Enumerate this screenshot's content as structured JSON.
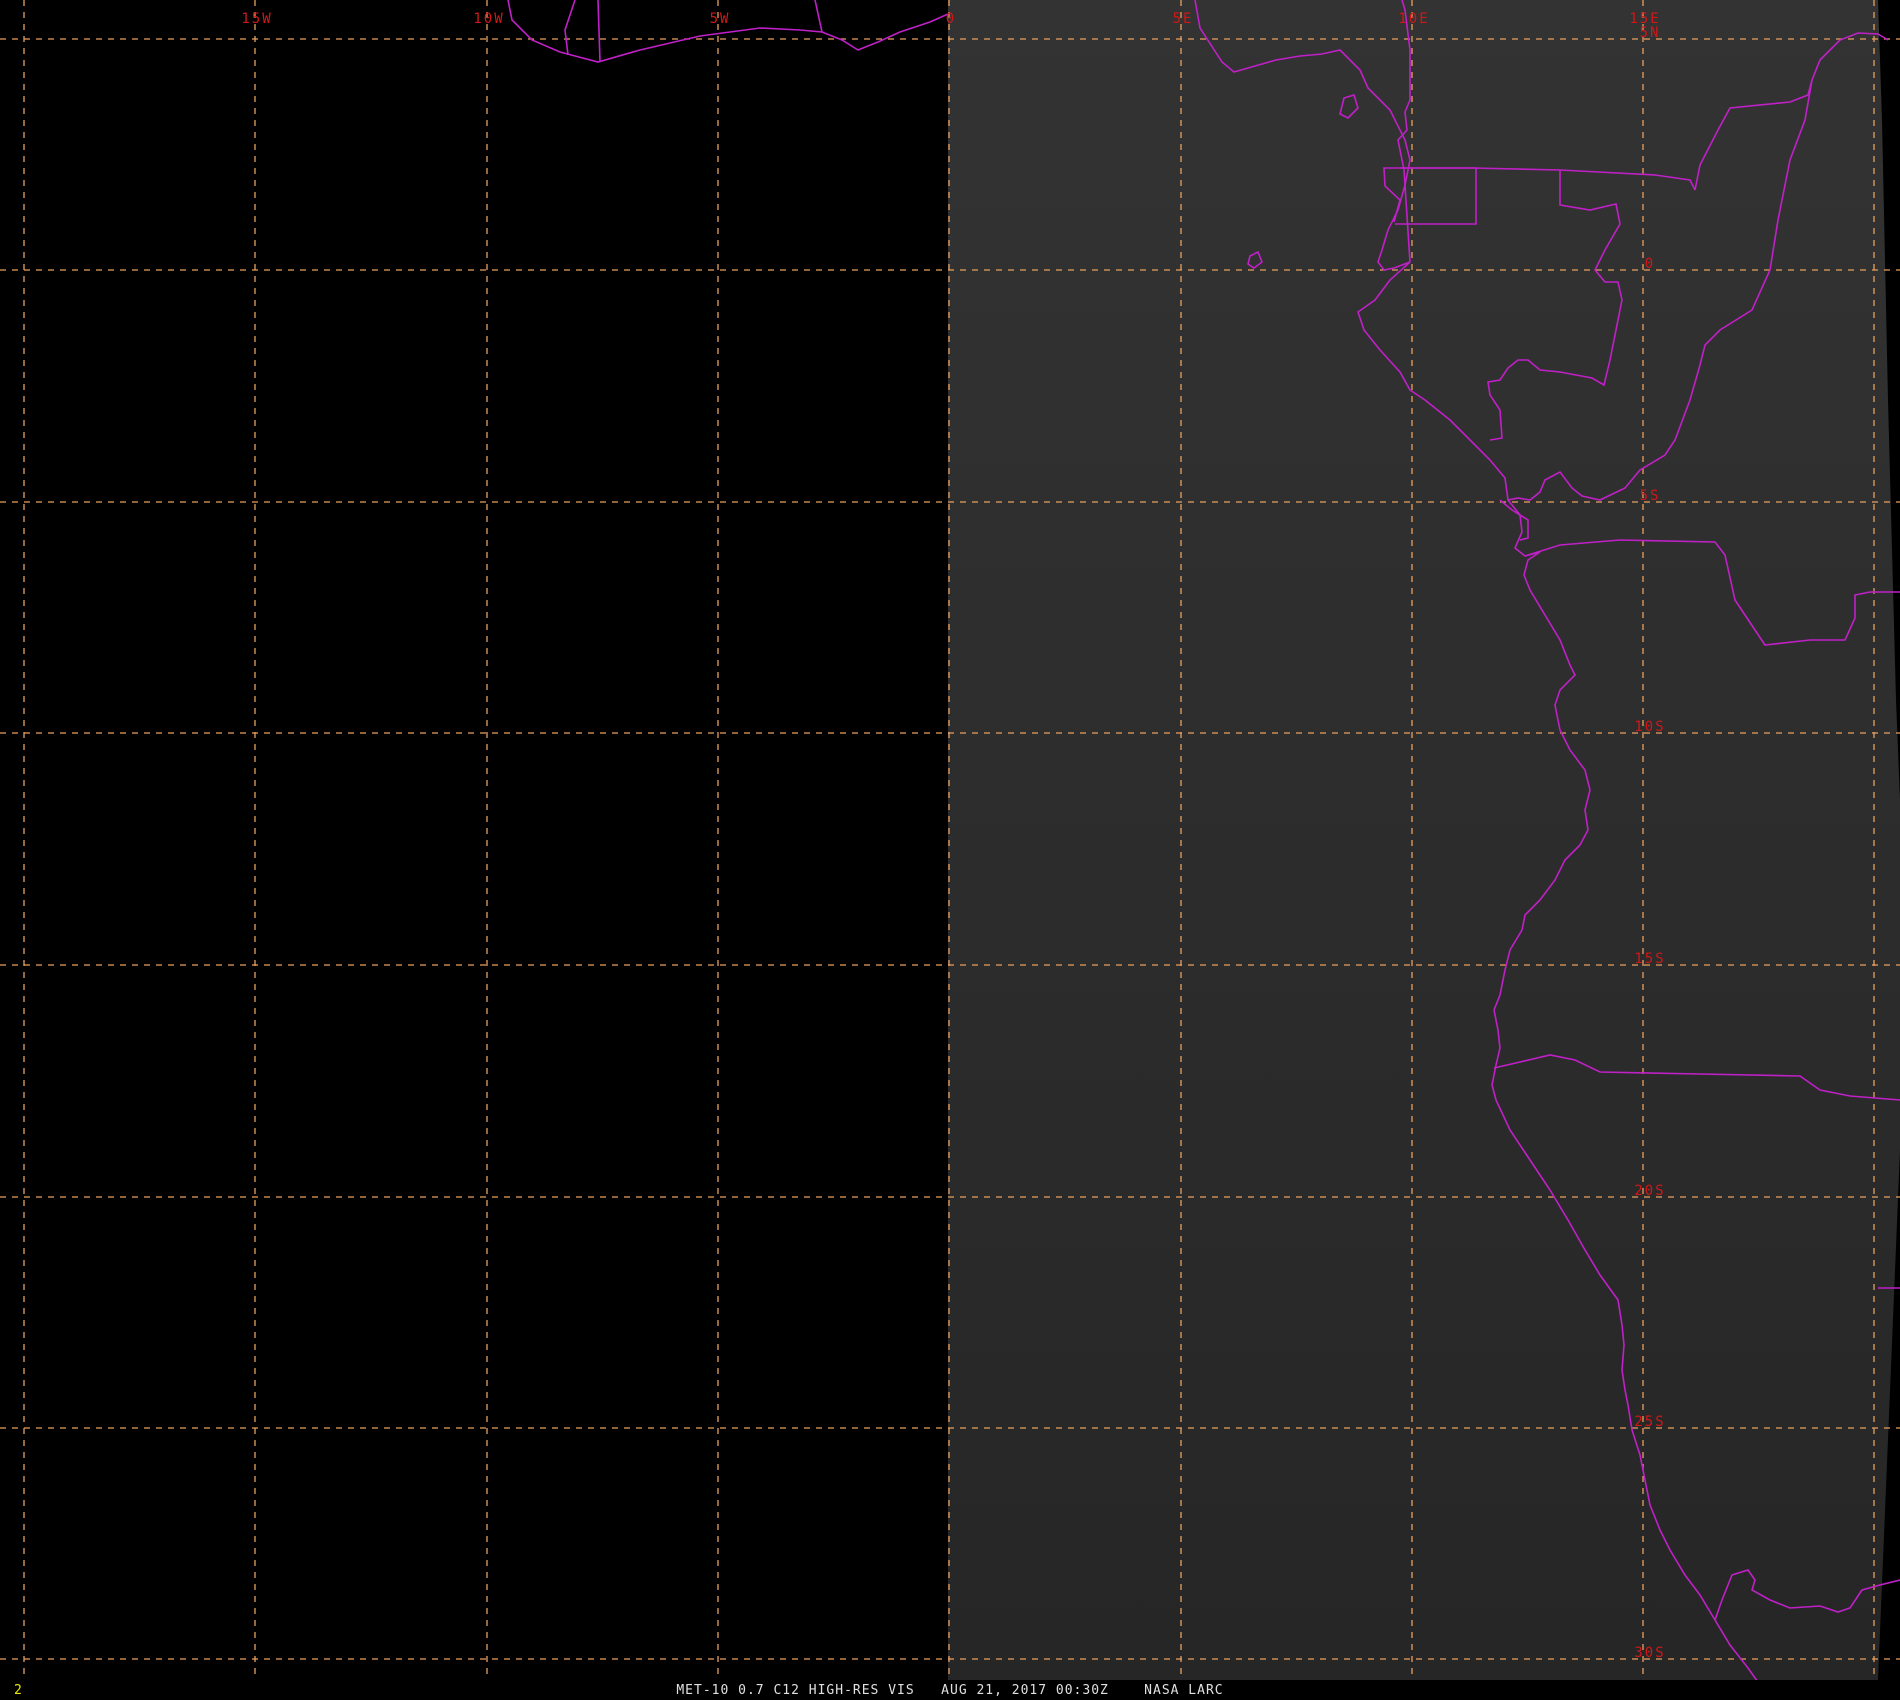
{
  "map": {
    "longitude_labels": [
      "15W",
      "10W",
      "5W",
      "0",
      "5E",
      "10E",
      "15E"
    ],
    "latitude_labels": [
      "5N",
      "0",
      "5S",
      "10S",
      "15S",
      "20S",
      "25S",
      "30S"
    ],
    "colors": {
      "background_day": "#2c2c2c",
      "background_night": "#000000",
      "grid": "#e8a060",
      "coastline": "#c020c8",
      "grid_label": "#d01818",
      "frame_number": "#e8e800",
      "caption": "#e0e0e0"
    }
  },
  "status": {
    "frame_number": "2",
    "caption": "MET-10 0.7 C12 HIGH-RES VIS   AUG 21, 2017 00:30Z    NASA LARC"
  }
}
